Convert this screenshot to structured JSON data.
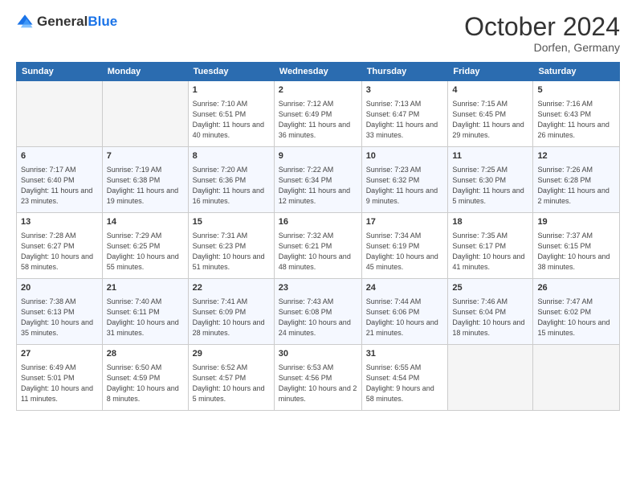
{
  "logo": {
    "general": "General",
    "blue": "Blue"
  },
  "header": {
    "title": "October 2024",
    "subtitle": "Dorfen, Germany"
  },
  "weekdays": [
    "Sunday",
    "Monday",
    "Tuesday",
    "Wednesday",
    "Thursday",
    "Friday",
    "Saturday"
  ],
  "weeks": [
    [
      {
        "day": "",
        "info": ""
      },
      {
        "day": "",
        "info": ""
      },
      {
        "day": "1",
        "info": "Sunrise: 7:10 AM\nSunset: 6:51 PM\nDaylight: 11 hours and 40 minutes."
      },
      {
        "day": "2",
        "info": "Sunrise: 7:12 AM\nSunset: 6:49 PM\nDaylight: 11 hours and 36 minutes."
      },
      {
        "day": "3",
        "info": "Sunrise: 7:13 AM\nSunset: 6:47 PM\nDaylight: 11 hours and 33 minutes."
      },
      {
        "day": "4",
        "info": "Sunrise: 7:15 AM\nSunset: 6:45 PM\nDaylight: 11 hours and 29 minutes."
      },
      {
        "day": "5",
        "info": "Sunrise: 7:16 AM\nSunset: 6:43 PM\nDaylight: 11 hours and 26 minutes."
      }
    ],
    [
      {
        "day": "6",
        "info": "Sunrise: 7:17 AM\nSunset: 6:40 PM\nDaylight: 11 hours and 23 minutes."
      },
      {
        "day": "7",
        "info": "Sunrise: 7:19 AM\nSunset: 6:38 PM\nDaylight: 11 hours and 19 minutes."
      },
      {
        "day": "8",
        "info": "Sunrise: 7:20 AM\nSunset: 6:36 PM\nDaylight: 11 hours and 16 minutes."
      },
      {
        "day": "9",
        "info": "Sunrise: 7:22 AM\nSunset: 6:34 PM\nDaylight: 11 hours and 12 minutes."
      },
      {
        "day": "10",
        "info": "Sunrise: 7:23 AM\nSunset: 6:32 PM\nDaylight: 11 hours and 9 minutes."
      },
      {
        "day": "11",
        "info": "Sunrise: 7:25 AM\nSunset: 6:30 PM\nDaylight: 11 hours and 5 minutes."
      },
      {
        "day": "12",
        "info": "Sunrise: 7:26 AM\nSunset: 6:28 PM\nDaylight: 11 hours and 2 minutes."
      }
    ],
    [
      {
        "day": "13",
        "info": "Sunrise: 7:28 AM\nSunset: 6:27 PM\nDaylight: 10 hours and 58 minutes."
      },
      {
        "day": "14",
        "info": "Sunrise: 7:29 AM\nSunset: 6:25 PM\nDaylight: 10 hours and 55 minutes."
      },
      {
        "day": "15",
        "info": "Sunrise: 7:31 AM\nSunset: 6:23 PM\nDaylight: 10 hours and 51 minutes."
      },
      {
        "day": "16",
        "info": "Sunrise: 7:32 AM\nSunset: 6:21 PM\nDaylight: 10 hours and 48 minutes."
      },
      {
        "day": "17",
        "info": "Sunrise: 7:34 AM\nSunset: 6:19 PM\nDaylight: 10 hours and 45 minutes."
      },
      {
        "day": "18",
        "info": "Sunrise: 7:35 AM\nSunset: 6:17 PM\nDaylight: 10 hours and 41 minutes."
      },
      {
        "day": "19",
        "info": "Sunrise: 7:37 AM\nSunset: 6:15 PM\nDaylight: 10 hours and 38 minutes."
      }
    ],
    [
      {
        "day": "20",
        "info": "Sunrise: 7:38 AM\nSunset: 6:13 PM\nDaylight: 10 hours and 35 minutes."
      },
      {
        "day": "21",
        "info": "Sunrise: 7:40 AM\nSunset: 6:11 PM\nDaylight: 10 hours and 31 minutes."
      },
      {
        "day": "22",
        "info": "Sunrise: 7:41 AM\nSunset: 6:09 PM\nDaylight: 10 hours and 28 minutes."
      },
      {
        "day": "23",
        "info": "Sunrise: 7:43 AM\nSunset: 6:08 PM\nDaylight: 10 hours and 24 minutes."
      },
      {
        "day": "24",
        "info": "Sunrise: 7:44 AM\nSunset: 6:06 PM\nDaylight: 10 hours and 21 minutes."
      },
      {
        "day": "25",
        "info": "Sunrise: 7:46 AM\nSunset: 6:04 PM\nDaylight: 10 hours and 18 minutes."
      },
      {
        "day": "26",
        "info": "Sunrise: 7:47 AM\nSunset: 6:02 PM\nDaylight: 10 hours and 15 minutes."
      }
    ],
    [
      {
        "day": "27",
        "info": "Sunrise: 6:49 AM\nSunset: 5:01 PM\nDaylight: 10 hours and 11 minutes."
      },
      {
        "day": "28",
        "info": "Sunrise: 6:50 AM\nSunset: 4:59 PM\nDaylight: 10 hours and 8 minutes."
      },
      {
        "day": "29",
        "info": "Sunrise: 6:52 AM\nSunset: 4:57 PM\nDaylight: 10 hours and 5 minutes."
      },
      {
        "day": "30",
        "info": "Sunrise: 6:53 AM\nSunset: 4:56 PM\nDaylight: 10 hours and 2 minutes."
      },
      {
        "day": "31",
        "info": "Sunrise: 6:55 AM\nSunset: 4:54 PM\nDaylight: 9 hours and 58 minutes."
      },
      {
        "day": "",
        "info": ""
      },
      {
        "day": "",
        "info": ""
      }
    ]
  ]
}
